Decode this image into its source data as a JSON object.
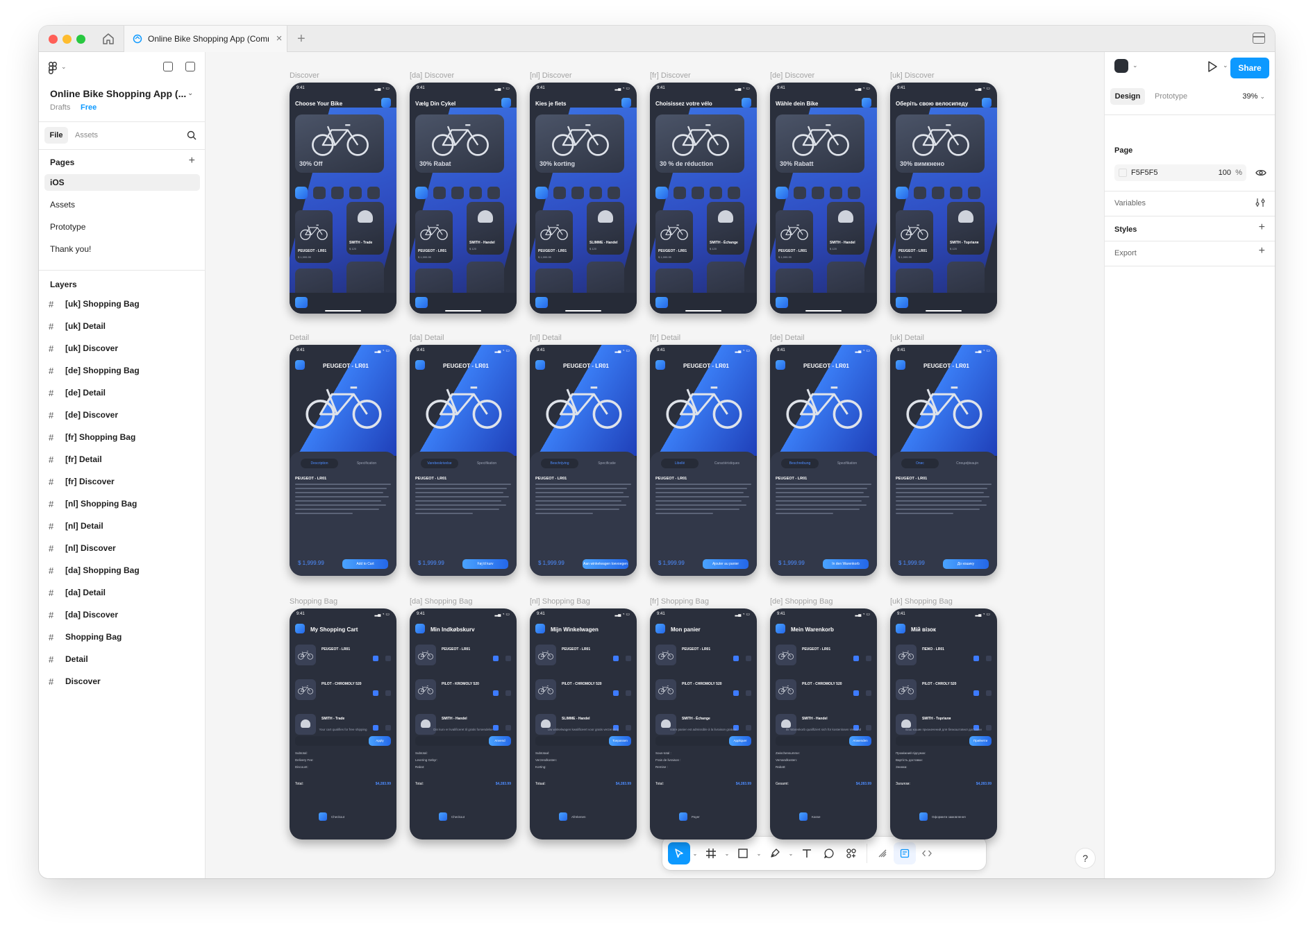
{
  "window": {
    "tab_title": "Online Bike Shopping App (Comr",
    "tab_close": "×",
    "new_tab": "+"
  },
  "left_panel": {
    "file_name": "Online Bike Shopping App (...",
    "drafts_label": "Drafts",
    "plan_label": "Free",
    "tab_file": "File",
    "tab_assets": "Assets",
    "pages_label": "Pages",
    "pages": [
      "iOS",
      "Assets",
      "Prototype",
      "Thank you!"
    ],
    "layers_label": "Layers",
    "layers": [
      "[uk] Shopping Bag",
      "[uk] Detail",
      "[uk] Discover",
      "[de] Shopping Bag",
      "[de] Detail",
      "[de] Discover",
      "[fr] Shopping Bag",
      "[fr] Detail",
      "[fr] Discover",
      "[nl] Shopping Bag",
      "[nl] Detail",
      "[nl] Discover",
      "[da] Shopping Bag",
      "[da] Detail",
      "[da] Discover",
      "Shopping Bag",
      "Detail",
      "Discover"
    ]
  },
  "canvas": {
    "status_time": "9:41",
    "discover": [
      {
        "label": "Discover",
        "title": "Choose Your Bike",
        "discount": "30% Off",
        "card1_name": "PEUGEOT - LR01",
        "card1_price": "$ 1,999.99",
        "card2_name": "SMITH - Trade",
        "card2_price": "$ 120"
      },
      {
        "label": "[da] Discover",
        "title": "Vælg Din Cykel",
        "discount": "30% Rabat",
        "card1_name": "PEUGEOT - LR01",
        "card1_price": "$ 1,999.99",
        "card2_name": "SMITH - Handel",
        "card2_price": "$ 120"
      },
      {
        "label": "[nl] Discover",
        "title": "Kies je fiets",
        "discount": "30% korting",
        "card1_name": "PEUGEOT - LR01",
        "card1_price": "$ 1,999.99",
        "card2_name": "SLIMME - Handel",
        "card2_price": "$ 120"
      },
      {
        "label": "[fr] Discover",
        "title": "Choisissez votre vélo",
        "discount": "30 % de réduction",
        "card1_name": "PEUGEOT - LR01",
        "card1_price": "$ 1,999.99",
        "card2_name": "SMITH - Échange",
        "card2_price": "$ 120"
      },
      {
        "label": "[de] Discover",
        "title": "Wähle dein Bike",
        "discount": "30% Rabatt",
        "card1_name": "PEUGEOT - LR01",
        "card1_price": "$ 1,999.99",
        "card2_name": "SMITH - Handel",
        "card2_price": "$ 120"
      },
      {
        "label": "[uk] Discover",
        "title": "Оберіть свою велосипеду",
        "discount": "30% вимкнено",
        "card1_name": "PEUGEOT - LR01",
        "card1_price": "$ 1,999.99",
        "card2_name": "SMITH - Торгівля",
        "card2_price": "$ 120"
      }
    ],
    "detail": [
      {
        "label": "Detail",
        "title": "PEUGEOT - LR01",
        "tab_on": "Description",
        "tab_off": "Specification",
        "name": "PEUGEOT - LR01",
        "price": "$ 1,999.99",
        "cta": "Add to Cart"
      },
      {
        "label": "[da] Detail",
        "title": "PEUGEOT - LR01",
        "tab_on": "Varebeskrivelse",
        "tab_off": "Specifikation",
        "name": "PEUGEOT - LR01",
        "price": "$ 1,999.99",
        "cta": "Føj til kurv"
      },
      {
        "label": "[nl] Detail",
        "title": "PEUGEOT - LR01",
        "tab_on": "Beschrijving",
        "tab_off": "Specificatie",
        "name": "PEUGEOT - LR01",
        "price": "$ 1,999.99",
        "cta": "Aan winkelwagen toevoegen"
      },
      {
        "label": "[fr] Detail",
        "title": "PEUGEOT - LR01",
        "tab_on": "Libellé",
        "tab_off": "Caractéristiques",
        "name": "PEUGEOT - LR01",
        "price": "$ 1,999.99",
        "cta": "Ajouter au panier"
      },
      {
        "label": "[de] Detail",
        "title": "PEUGEOT - LR01",
        "tab_on": "Beschreibung",
        "tab_off": "Spezifikation",
        "name": "PEUGEOT - LR01",
        "price": "$ 1,999.99",
        "cta": "In den Warenkorb"
      },
      {
        "label": "[uk] Detail",
        "title": "PEUGEOT - LR01",
        "tab_on": "Опис",
        "tab_off": "Специфікація",
        "name": "PEUGEOT - LR01",
        "price": "$ 1,999.99",
        "cta": "До кошику"
      }
    ],
    "bag": [
      {
        "label": "Shopping Bag",
        "title": "My Shopping Cart",
        "items": [
          "PEUGEOT - LR01",
          "PILOT - CHROMOLY 520",
          "SMITH - Trade"
        ],
        "note": "Your cart qualifies for free shipping",
        "apply": "Apply",
        "subtotal": "Subtotal:",
        "delivery": "Delivery Fee:",
        "discount": "Discount:",
        "total": "Total:",
        "total_value": "$4,283.99",
        "checkout": "Checkout"
      },
      {
        "label": "[da] Shopping Bag",
        "title": "Min Indkøbskurv",
        "items": [
          "PEUGEOT - LR01",
          "PILOT - KROMOLY 520",
          "SMITH - Handel"
        ],
        "note": "Din kurv er kvalificeret til gratis forsendelse",
        "apply": "Anvend",
        "subtotal": "Subtotal:",
        "delivery": "Levering Gebyr:",
        "discount": "Rabat:",
        "total": "Total:",
        "total_value": "$4,283.99",
        "checkout": "Checkout"
      },
      {
        "label": "[nl] Shopping Bag",
        "title": "Mijn Winkelwagen",
        "items": [
          "PEUGEOT - LR01",
          "PILOT - CHROMOLY 520",
          "SLIMME - Handel"
        ],
        "note": "Uw winkelwagen kwalificeert voor gratis verzending",
        "apply": "Toepassen",
        "subtotal": "Subtotaal:",
        "delivery": "Verzendkosten:",
        "discount": "Korting:",
        "total": "Totaal:",
        "total_value": "$4,283.99",
        "checkout": "Afrekenen"
      },
      {
        "label": "[fr] Shopping Bag",
        "title": "Mon panier",
        "items": [
          "PEUGEOT - LR01",
          "PILOT - CHROMOLY 520",
          "SMITH - Échange"
        ],
        "note": "Votre panier est admissible à la livraison gratuite",
        "apply": "Appliquer",
        "subtotal": "Sous-total :",
        "delivery": "Frais de livraison :",
        "discount": "Remise :",
        "total": "Total:",
        "total_value": "$4,283.99",
        "checkout": "Payer"
      },
      {
        "label": "[de] Shopping Bag",
        "title": "Mein Warenkorb",
        "items": [
          "PEUGEOT - LR01",
          "PILOT - CHROMOLY 520",
          "SMITH - Handel"
        ],
        "note": "Ihr Warenkorb qualifiziert sich für kostenlosen Versand",
        "apply": "Anwenden",
        "subtotal": "Zwischensumme:",
        "delivery": "Versandkosten:",
        "discount": "Rabatt:",
        "total": "Gesamt:",
        "total_value": "$4,283.99",
        "checkout": "Kasse"
      },
      {
        "label": "[uk] Shopping Bag",
        "title": "Мій візок",
        "items": [
          "ПЕЖО - LR01",
          "PILOT - CHROLY 520",
          "SMITH - Торгівля"
        ],
        "note": "Ваш кошик призначений для безкоштовної доставки",
        "apply": "Прийняти",
        "subtotal": "Проміжний підсумок:",
        "delivery": "Вартість доставки:",
        "discount": "Знижка:",
        "total": "Загалом:",
        "total_value": "$4,283.99",
        "checkout": "Оформити замовлення"
      }
    ]
  },
  "right_panel": {
    "share_label": "Share",
    "tab_design": "Design",
    "tab_prototype": "Prototype",
    "zoom": "39%",
    "page_label": "Page",
    "page_color": "F5F5F5",
    "page_opacity": "100",
    "page_opacity_unit": "%",
    "variables_label": "Variables",
    "styles_label": "Styles",
    "export_label": "Export"
  },
  "help_label": "?",
  "colors": {
    "accent": "#0d99ff",
    "phone_bg": "#2a2f3c",
    "app_blue": "#3d7bff"
  }
}
